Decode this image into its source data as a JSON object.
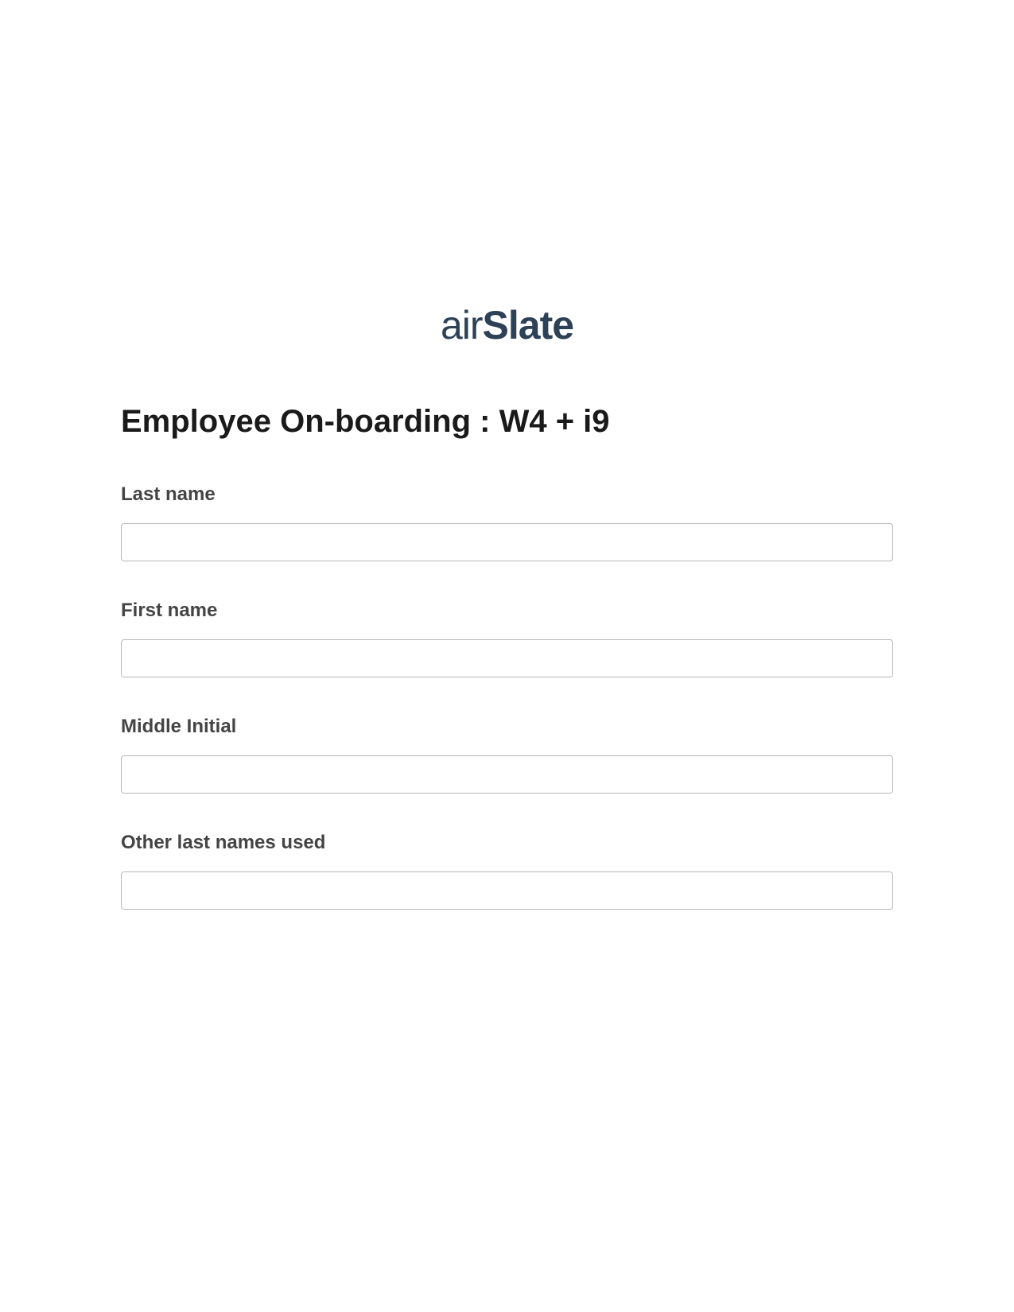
{
  "logo": {
    "prefix": "air",
    "suffix": "Slate"
  },
  "title": "Employee On-boarding : W4 + i9",
  "fields": {
    "last_name": {
      "label": "Last name",
      "value": ""
    },
    "first_name": {
      "label": "First name",
      "value": ""
    },
    "middle_initial": {
      "label": "Middle Initial",
      "value": ""
    },
    "other_last_names": {
      "label": "Other last names used",
      "value": ""
    }
  }
}
